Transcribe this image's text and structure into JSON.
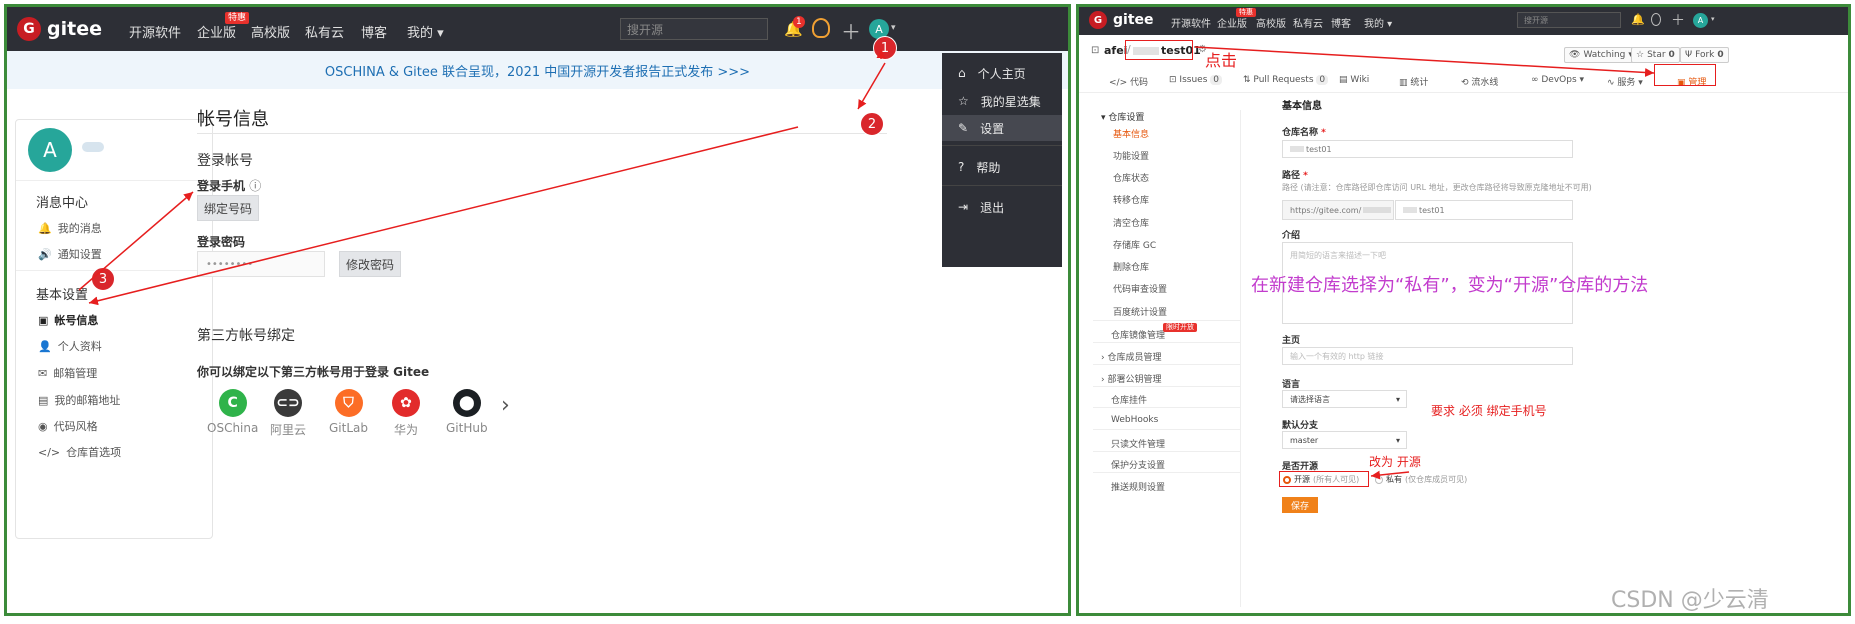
{
  "left": {
    "nav": {
      "logo_text": "gitee",
      "items": [
        "开源软件",
        "企业版",
        "高校版",
        "私有云",
        "博客",
        "我的"
      ],
      "enterprise_badge": "特惠",
      "search_placeholder": "搜开源",
      "bell_badge": "1",
      "avatar_letter": "A"
    },
    "banner": "OSCHINA & Gitee 联合呈现，2021 中国开源开发者报告正式发布 >>>",
    "sidebar": {
      "avatar_letter": "A",
      "msg_header": "消息中心",
      "msg_items": [
        "我的消息",
        "通知设置"
      ],
      "basic_header": "基本设置",
      "basic_items": [
        "帐号信息",
        "个人资料",
        "邮箱管理",
        "我的邮箱地址",
        "代码风格",
        "仓库首选项"
      ]
    },
    "main": {
      "title": "帐号信息",
      "login_account": "登录帐号",
      "phone_label": "登录手机",
      "bind_phone_button": "绑定号码",
      "password_label": "登录密码",
      "password_value": "••••••••",
      "change_password_button": "修改密码",
      "third_party_title": "第三方帐号绑定",
      "third_party_desc": "你可以绑定以下第三方帐号用于登录 Gitee",
      "providers": [
        {
          "name": "OSChina",
          "color": "#2fb34a"
        },
        {
          "name": "阿里云",
          "color": "#3a3a3a"
        },
        {
          "name": "GitLab",
          "color": "#fc6d26"
        },
        {
          "name": "华为",
          "color": "#e22b2b"
        },
        {
          "name": "GitHub",
          "color": "#1b1f23"
        }
      ]
    },
    "dropdown": {
      "items": [
        "个人主页",
        "我的星选集",
        "设置",
        "帮助",
        "退出"
      ]
    },
    "markers": [
      "1",
      "2",
      "3"
    ]
  },
  "right": {
    "nav": {
      "logo_text": "gitee",
      "items": [
        "开源软件",
        "企业版",
        "高校版",
        "私有云",
        "博客",
        "我的"
      ],
      "enterprise_badge": "特惠",
      "search_placeholder": "搜开源",
      "avatar_letter": "A"
    },
    "repo": {
      "owner": "afei",
      "name": "test01",
      "watch_label": "Watching",
      "watch_count": "1",
      "star_label": "Star",
      "star_count": "0",
      "fork_label": "Fork",
      "fork_count": "0"
    },
    "tabs": [
      {
        "label": "代码",
        "count": ""
      },
      {
        "label": "Issues",
        "count": "0"
      },
      {
        "label": "Pull Requests",
        "count": "0"
      },
      {
        "label": "Wiki",
        "count": ""
      },
      {
        "label": "统计",
        "count": ""
      },
      {
        "label": "流水线",
        "count": ""
      },
      {
        "label": "DevOps",
        "count": ""
      },
      {
        "label": "服务",
        "count": ""
      },
      {
        "label": "管理",
        "count": ""
      }
    ],
    "side": {
      "group": "仓库设置",
      "items": [
        "基本信息",
        "功能设置",
        "仓库状态",
        "转移仓库",
        "清空仓库",
        "存储库 GC",
        "删除仓库",
        "代码审查设置",
        "百度统计设置"
      ],
      "others": [
        "仓库镜像管理",
        "仓库成员管理",
        "部署公钥管理",
        "仓库挂件",
        "WebHooks",
        "只读文件管理",
        "保护分支设置",
        "推送规则设置"
      ],
      "mirror_badge": "限时开放"
    },
    "form": {
      "title": "基本信息",
      "repo_name_label": "仓库名称",
      "repo_name_value": "test01",
      "path_label": "路径",
      "path_hint": "路径 (请注意：仓库路径即仓库访问 URL 地址，更改仓库路径将导致原克隆地址不可用)",
      "path_prefix": "https://gitee.com/",
      "path_value": "test01",
      "intro_label": "介绍",
      "intro_placeholder": "用简短的语言来描述一下吧",
      "home_label": "主页",
      "home_placeholder": "输入一个有效的 http 链接",
      "lang_label": "语言",
      "lang_value": "请选择语言",
      "branch_label": "默认分支",
      "branch_value": "master",
      "open_label": "是否开源",
      "open_option": "开源",
      "open_option_hint": "(所有人可见)",
      "private_option": "私有",
      "private_option_hint": "(仅仓库成员可见)",
      "save_button": "保存"
    },
    "annotations": {
      "click": "点击",
      "main_caption": "在新建仓库选择为“私有”，变为“开源”仓库的方法",
      "require_phone": "要求 必须 绑定手机号",
      "change_open": "改为 开源"
    }
  },
  "watermark": "CSDN @少云清"
}
